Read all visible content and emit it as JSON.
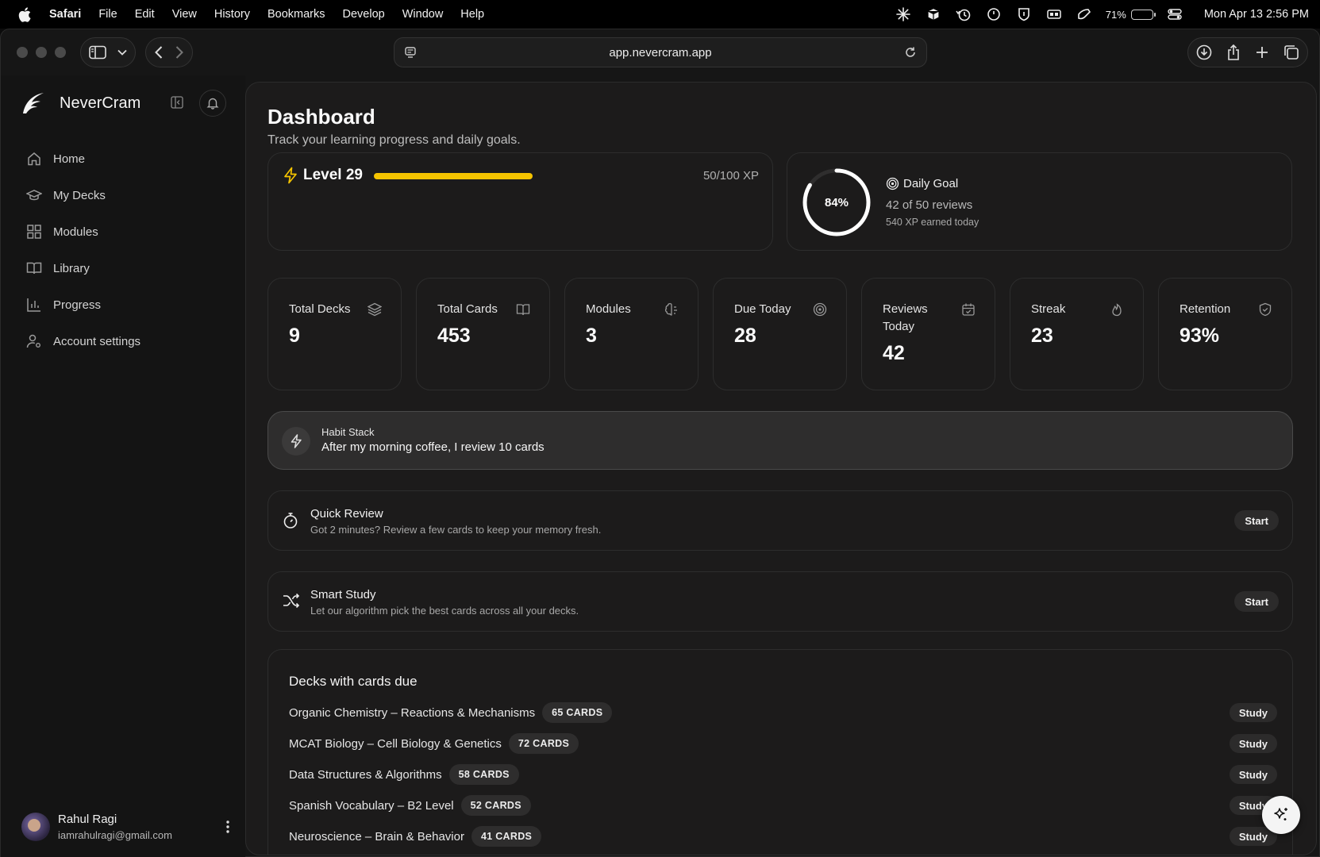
{
  "menubar": {
    "app": "Safari",
    "items": [
      "File",
      "Edit",
      "View",
      "History",
      "Bookmarks",
      "Develop",
      "Window",
      "Help"
    ],
    "battery": "71%",
    "battery_level": 0.71,
    "datetime": "Mon Apr 13  2:56 PM"
  },
  "browser": {
    "url": "app.nevercram.app"
  },
  "sidebar": {
    "brand": "NeverCram",
    "items": [
      {
        "label": "Home",
        "icon": "home-icon"
      },
      {
        "label": "My Decks",
        "icon": "graduation-cap-icon"
      },
      {
        "label": "Modules",
        "icon": "grid-icon"
      },
      {
        "label": "Library",
        "icon": "book-open-icon"
      },
      {
        "label": "Progress",
        "icon": "bar-chart-icon"
      },
      {
        "label": "Account settings",
        "icon": "user-cog-icon"
      }
    ],
    "user": {
      "name": "Rahul Ragi",
      "email": "iamrahulragi@gmail.com"
    }
  },
  "dashboard": {
    "title": "Dashboard",
    "subtitle": "Track your learning progress and daily goals.",
    "level": {
      "label": "Level 29",
      "xp": "50/100 XP",
      "progress": 0.5
    },
    "daily_goal": {
      "percent_label": "84%",
      "percent": 84,
      "title": "Daily Goal",
      "reviews": "42 of 50 reviews",
      "xp_today": "540 XP earned today"
    },
    "stats": [
      {
        "label": "Total Decks",
        "value": "9",
        "icon": "layers-icon"
      },
      {
        "label": "Total Cards",
        "value": "453",
        "icon": "book-open-icon"
      },
      {
        "label": "Modules",
        "value": "3",
        "icon": "brain-icon"
      },
      {
        "label": "Due Today",
        "value": "28",
        "icon": "target-icon"
      },
      {
        "label": "Reviews Today",
        "value": "42",
        "icon": "calendar-check-icon"
      },
      {
        "label": "Streak",
        "value": "23",
        "icon": "flame-icon"
      },
      {
        "label": "Retention",
        "value": "93%",
        "icon": "shield-icon"
      }
    ],
    "habit": {
      "title": "Habit Stack",
      "text": "After my morning coffee, I review 10 cards"
    },
    "quick_review": {
      "title": "Quick Review",
      "subtitle": "Got 2 minutes? Review a few cards to keep your memory fresh.",
      "button": "Start"
    },
    "smart_study": {
      "title": "Smart Study",
      "subtitle": "Let our algorithm pick the best cards across all your decks.",
      "button": "Start"
    },
    "decks": {
      "title": "Decks with cards due",
      "button": "Study",
      "items": [
        {
          "name": "Organic Chemistry – Reactions & Mechanisms",
          "badge": "65 CARDS"
        },
        {
          "name": "MCAT Biology – Cell Biology & Genetics",
          "badge": "72 CARDS"
        },
        {
          "name": "Data Structures & Algorithms",
          "badge": "58 CARDS"
        },
        {
          "name": "Spanish Vocabulary – B2 Level",
          "badge": "52 CARDS"
        },
        {
          "name": "Neuroscience – Brain & Behavior",
          "badge": "41 CARDS"
        }
      ]
    }
  },
  "colors": {
    "accent": "#f5c400",
    "background": "#1c1b1b"
  }
}
